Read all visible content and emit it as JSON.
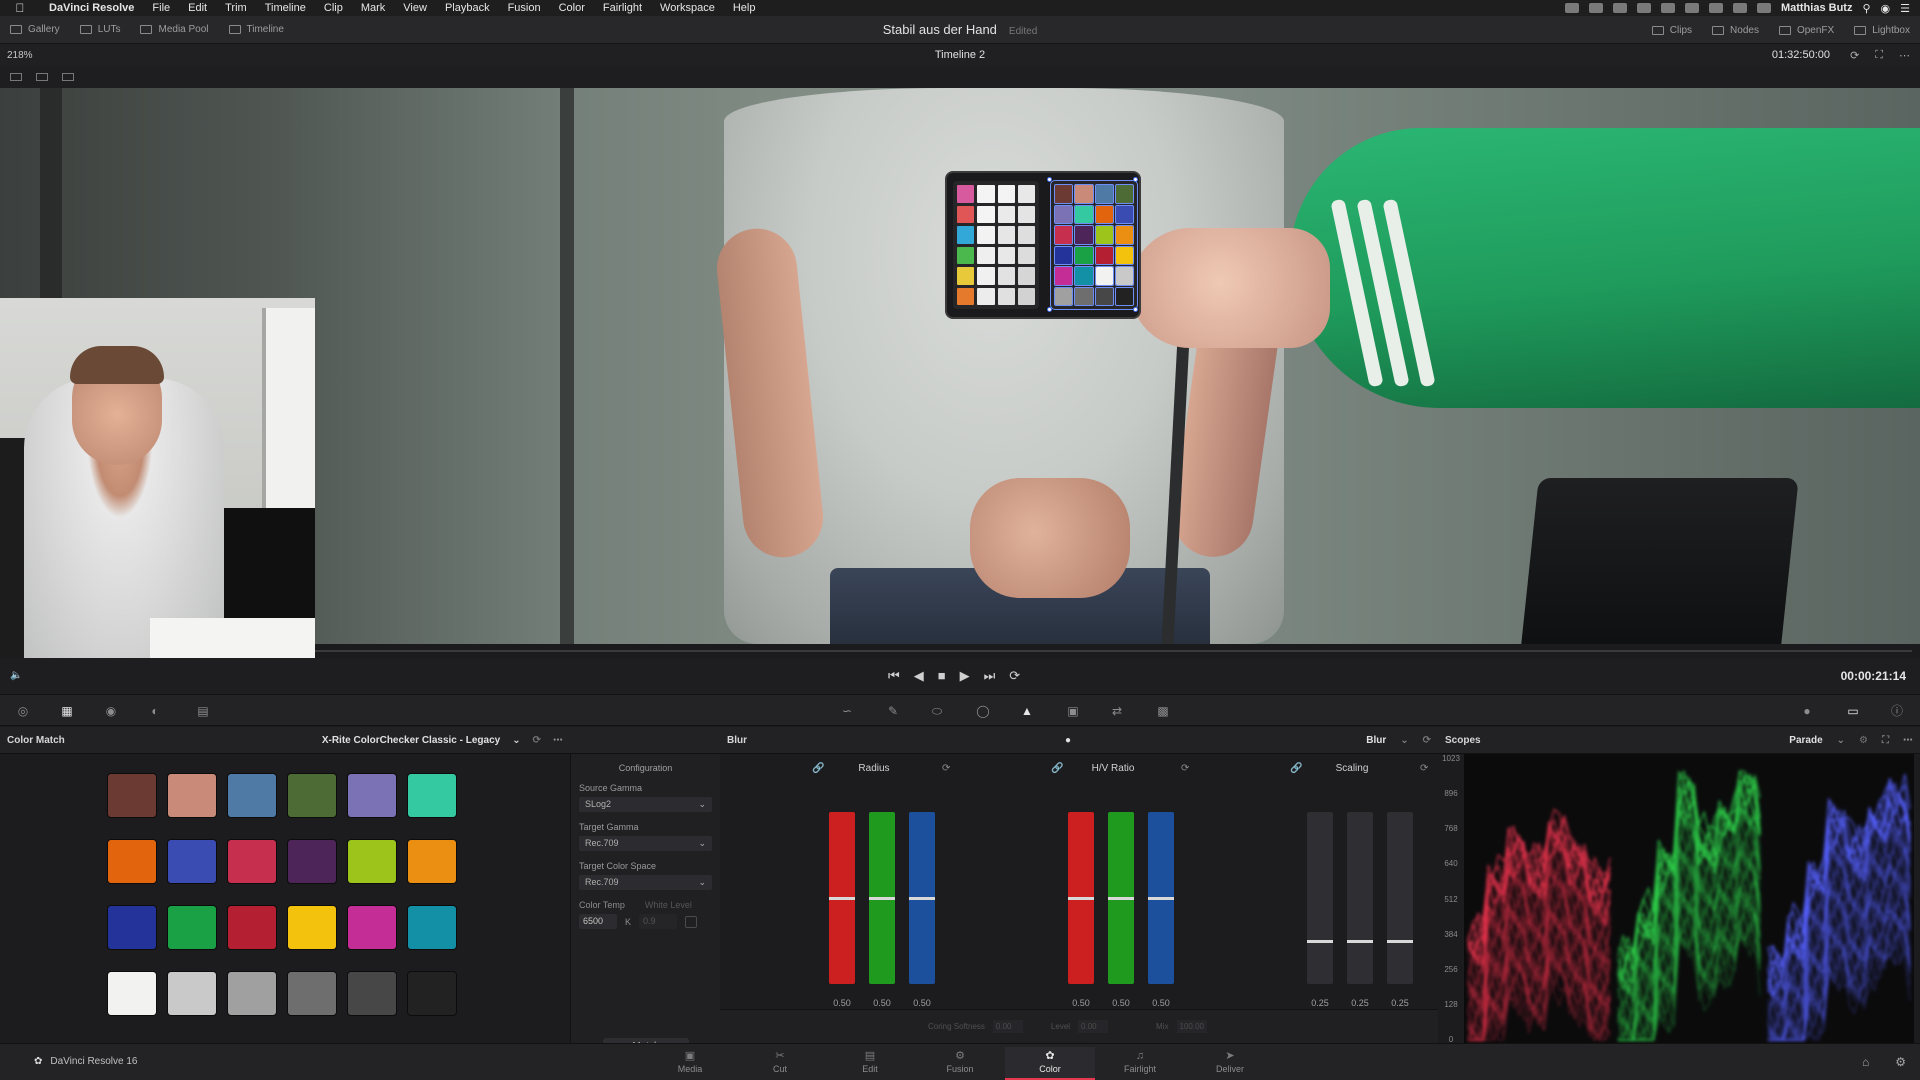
{
  "menubar": {
    "app_name": "DaVinci Resolve",
    "items": [
      "File",
      "Edit",
      "Trim",
      "Timeline",
      "Clip",
      "Mark",
      "View",
      "Playback",
      "Fusion",
      "Color",
      "Fairlight",
      "Workspace",
      "Help"
    ],
    "user": "Matthias Butz"
  },
  "toolbar": {
    "left": [
      {
        "label": "Gallery",
        "icon": "gallery-icon"
      },
      {
        "label": "LUTs",
        "icon": "luts-icon"
      },
      {
        "label": "Media Pool",
        "icon": "media-pool-icon"
      },
      {
        "label": "Timeline",
        "icon": "timeline-icon"
      }
    ],
    "project_title": "Stabil aus der Hand",
    "project_status": "Edited",
    "right": [
      {
        "label": "Clips",
        "icon": "clips-icon"
      },
      {
        "label": "Nodes",
        "icon": "nodes-icon"
      },
      {
        "label": "OpenFX",
        "icon": "openfx-icon"
      },
      {
        "label": "Lightbox",
        "icon": "lightbox-icon"
      }
    ]
  },
  "viewer": {
    "zoom": "218%",
    "timeline_name": "Timeline 2",
    "timecode_top": "01:32:50:00",
    "timecode_main": "00:00:21:14"
  },
  "color_match": {
    "title": "Color Match",
    "chart_selector": "X-Rite ColorChecker Classic - Legacy",
    "swatches": [
      "#6b3a33",
      "#c98a7a",
      "#4f7aa6",
      "#4d6b34",
      "#7a72b4",
      "#34c9a0",
      "#e2650e",
      "#3a4bb1",
      "#c62f4d",
      "#4e2558",
      "#9cc41b",
      "#ea8f12",
      "#24339a",
      "#1aa045",
      "#b41f31",
      "#f2c20d",
      "#c42d96",
      "#1490a6",
      "#f2f2f0",
      "#c9c9c9",
      "#a0a0a0",
      "#6e6e6e",
      "#474747",
      "#222222"
    ],
    "config": {
      "title": "Configuration",
      "source_gamma_label": "Source Gamma",
      "source_gamma": "SLog2",
      "target_gamma_label": "Target Gamma",
      "target_gamma": "Rec.709",
      "target_space_label": "Target Color Space",
      "target_space": "Rec.709",
      "color_temp_label": "Color Temp",
      "white_level_label": "White Level",
      "color_temp": "6500",
      "color_temp_unit": "K",
      "white_level": "0.9",
      "match_button": "Match"
    }
  },
  "blur": {
    "title": "Blur",
    "mode": "Blur",
    "groups": [
      {
        "title": "Radius",
        "values": [
          "0.50",
          "0.50",
          "0.50"
        ],
        "level": 0.5
      },
      {
        "title": "H/V Ratio",
        "values": [
          "0.50",
          "0.50",
          "0.50"
        ],
        "level": 0.5
      },
      {
        "title": "Scaling",
        "values": [
          "0.25",
          "0.25",
          "0.25"
        ],
        "level": 0.25
      }
    ],
    "channels": [
      "R",
      "G",
      "B"
    ],
    "footer": [
      {
        "label": "Coring Softness",
        "value": "0.00"
      },
      {
        "label": "Level",
        "value": "0.00"
      },
      {
        "label": "Mix",
        "value": "100.00"
      }
    ]
  },
  "scopes": {
    "title": "Scopes",
    "mode": "Parade",
    "y_ticks": [
      "1023",
      "896",
      "768",
      "640",
      "512",
      "384",
      "256",
      "128",
      "0"
    ]
  },
  "pages": {
    "brand": "DaVinci Resolve 16",
    "items": [
      "Media",
      "Cut",
      "Edit",
      "Fusion",
      "Color",
      "Fairlight",
      "Deliver"
    ],
    "active": "Color"
  },
  "colors": {
    "accent_active_page": "#e63950",
    "selection_blue": "#4470f0"
  }
}
